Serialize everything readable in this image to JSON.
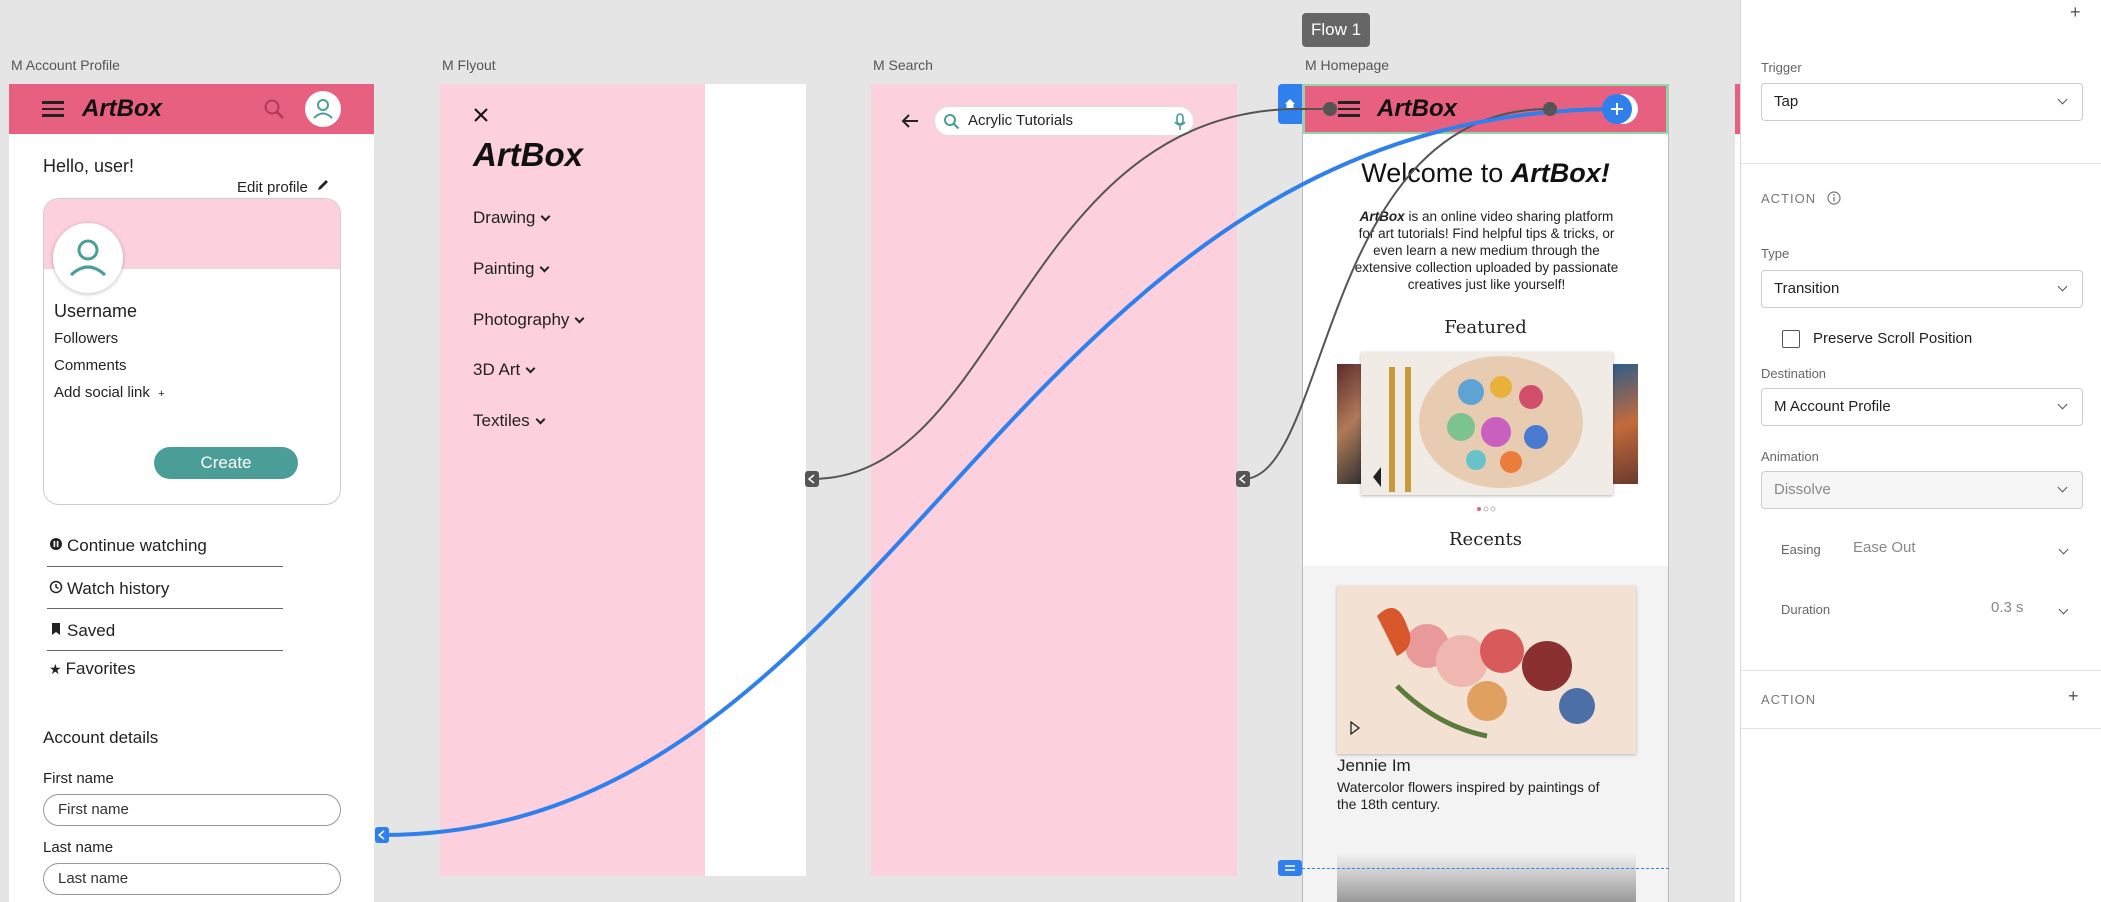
{
  "flow_label": "Flow 1",
  "artboards": {
    "account": {
      "label": "M Account Profile",
      "logo": "ArtBox",
      "greeting": "Hello, user!",
      "edit_profile": "Edit profile",
      "username": "Username",
      "followers": "Followers",
      "comments": "Comments",
      "add_social": "Add social link",
      "add_social_plus": "+",
      "create_label": "Create",
      "menu": [
        {
          "label": "Continue watching",
          "icon": "pause-circle-icon"
        },
        {
          "label": "Watch history",
          "icon": "history-icon"
        },
        {
          "label": "Saved",
          "icon": "bookmark-icon"
        },
        {
          "label": "Favorites",
          "icon": "star-icon"
        }
      ],
      "account_details": "Account details",
      "first_name_label": "First name",
      "first_name_placeholder": "First name",
      "last_name_label": "Last name",
      "last_name_placeholder": "Last name"
    },
    "flyout": {
      "label": "M Flyout",
      "logo": "ArtBox",
      "items": [
        "Drawing",
        "Painting",
        "Photography",
        "3D Art",
        "Textiles"
      ]
    },
    "search": {
      "label": "M Search",
      "query": "Acrylic Tutorials"
    },
    "home": {
      "label": "M Homepage",
      "logo": "ArtBox",
      "welcome_prefix": "Welcome to",
      "welcome_brand": "ArtBox!",
      "intro_brand": "ArtBox",
      "intro_line1": " is an online video sharing platform",
      "intro_line2": "for art tutorials! Find helpful tips & tricks, or",
      "intro_line3": "even learn a new medium through the",
      "intro_line4": "extensive collection uploaded by passionate",
      "intro_line5": "creatives just like yourself!",
      "featured": "Featured",
      "recents": "Recents",
      "video_author": "Jennie Im",
      "video_desc_line1": "Watercolor flowers inspired by paintings of",
      "video_desc_line2": "the 18th century."
    }
  },
  "panel": {
    "plus": "+",
    "trigger_label": "Trigger",
    "trigger_value": "Tap",
    "action_title": "ACTION",
    "type_label": "Type",
    "type_value": "Transition",
    "preserve_scroll": "Preserve Scroll Position",
    "preserve_scroll_checked": false,
    "destination_label": "Destination",
    "destination_value": "M Account Profile",
    "animation_label": "Animation",
    "animation_value": "Dissolve",
    "easing_label": "Easing",
    "easing_value": "Ease Out",
    "duration_label": "Duration",
    "duration_value": "0.3 s",
    "action2_title": "ACTION",
    "action2_plus": "+"
  },
  "colors": {
    "brand_pink": "#e8607f",
    "light_pink": "#fcd0dd",
    "teal": "#4a9e97",
    "wire_blue": "#2f80ed",
    "wire_gray": "#555555"
  }
}
